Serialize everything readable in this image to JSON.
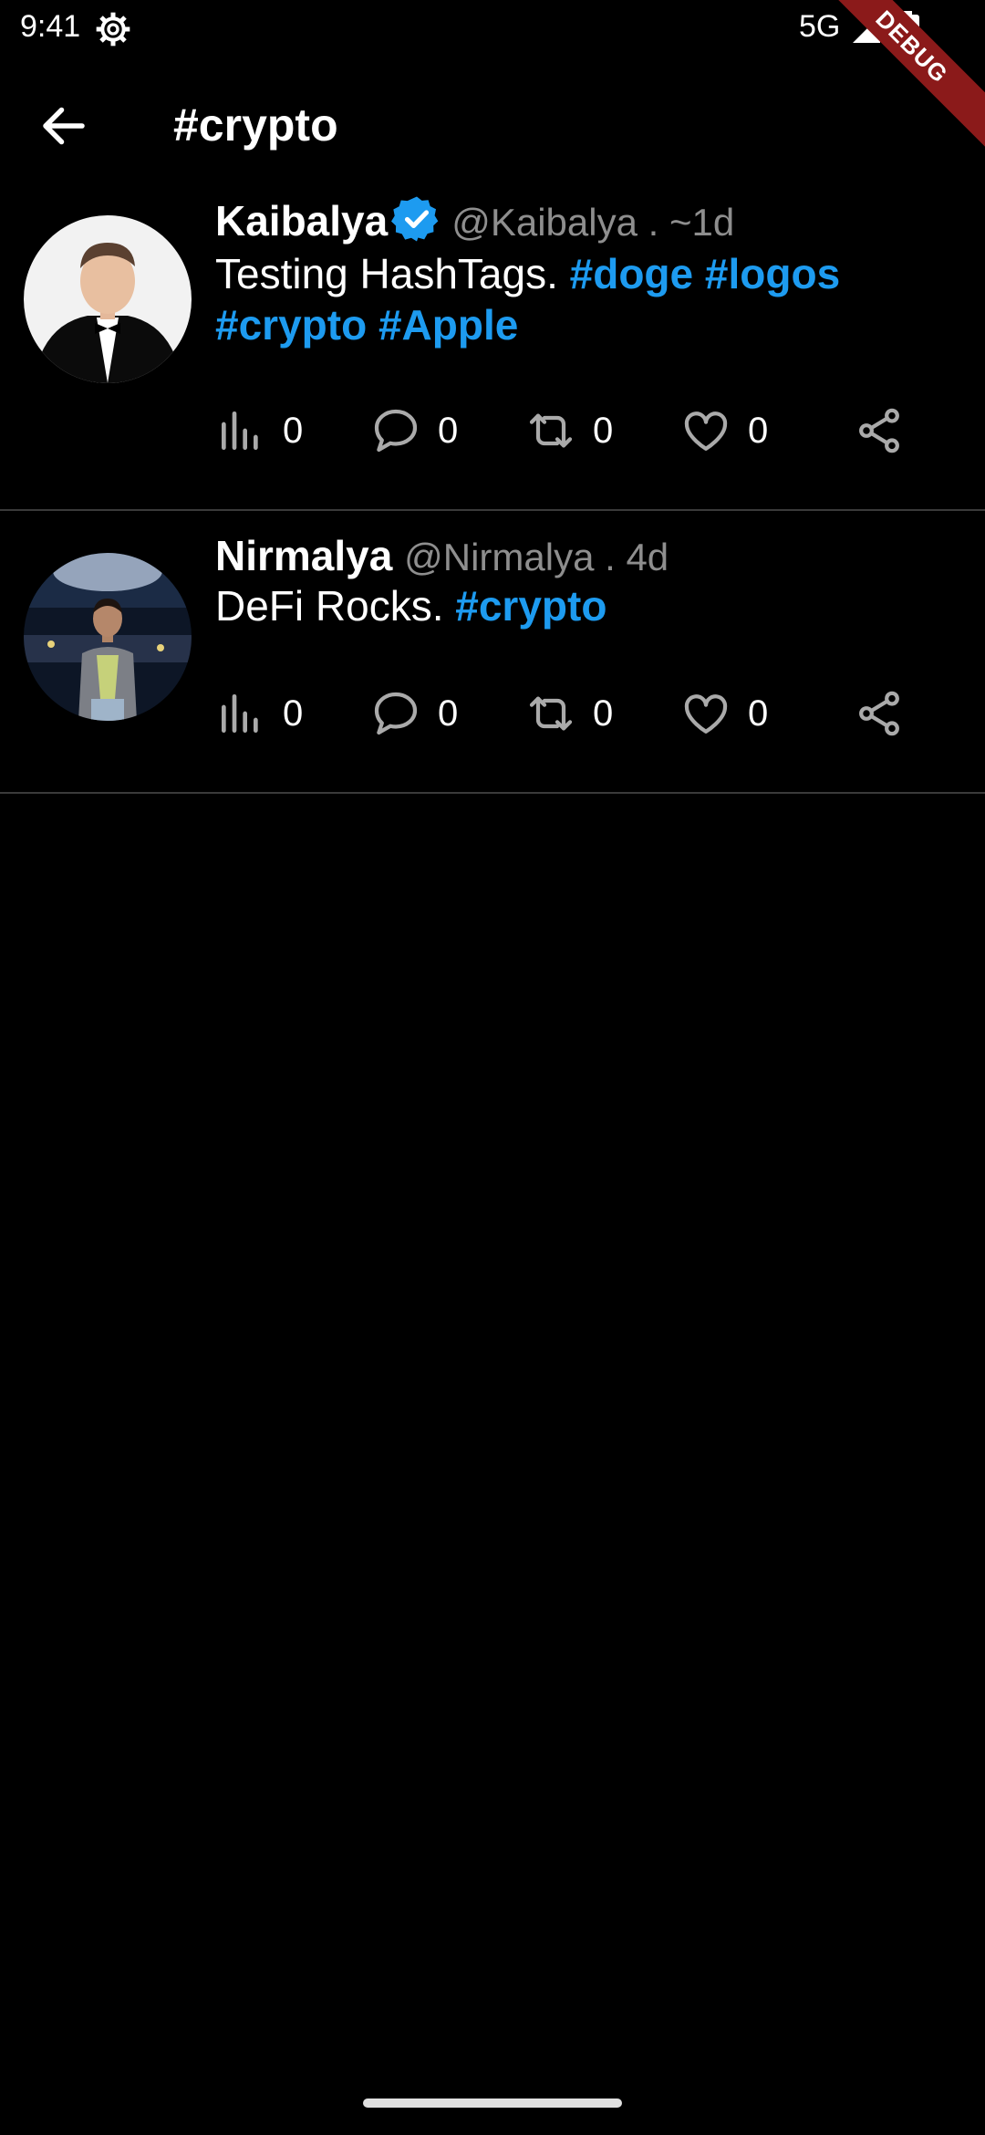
{
  "status_bar": {
    "time": "9:41",
    "network": "5G",
    "debug_label": "DEBUG"
  },
  "app_bar": {
    "title": "#crypto",
    "back_icon": "arrow-left-icon"
  },
  "tweets": [
    {
      "name": "Kaibalya",
      "verified": true,
      "handle_time": "@Kaibalya . ~1d",
      "text_plain": "Testing HashTags. ",
      "hashtags": [
        "#doge",
        "#logos",
        "#crypto",
        "#Apple"
      ],
      "views": "0",
      "replies": "0",
      "retweets": "0",
      "likes": "0"
    },
    {
      "name": "Nirmalya",
      "verified": false,
      "handle_time": "@Nirmalya . 4d",
      "text_plain": "DeFi Rocks. ",
      "hashtags": [
        "#crypto"
      ],
      "views": "0",
      "replies": "0",
      "retweets": "0",
      "likes": "0"
    }
  ],
  "colors": {
    "background": "#000000",
    "accent": "#1d9bf0",
    "muted": "#8e8e8e",
    "divider": "#3a3a3a"
  }
}
